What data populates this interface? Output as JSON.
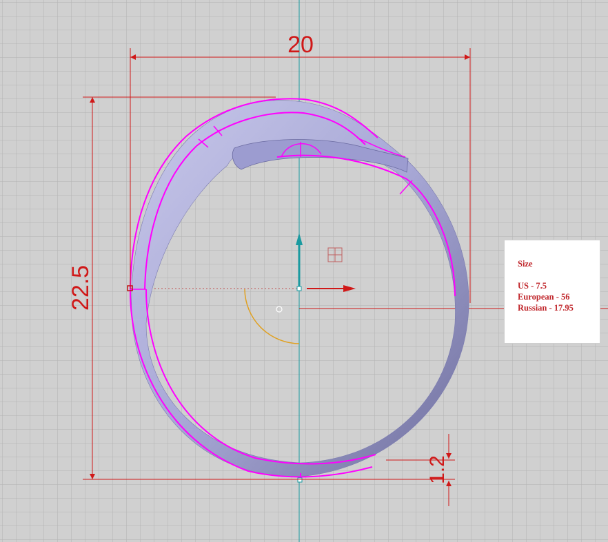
{
  "dimensions": {
    "width_label": "20",
    "height_label": "22.5",
    "thickness_label": "1.2"
  },
  "size_panel": {
    "title": "Size",
    "us": "US - 7.5",
    "european": "European - 56",
    "russian": "Russian - 17.95"
  },
  "colors": {
    "background": "#d0d0d0",
    "grid": "#b4b4b4",
    "dimension": "#d01818",
    "ring_body": "#a6a6d2",
    "ring_edges": "#ff00ff",
    "axis": "#1a9aa0",
    "arc": "#e0a020"
  }
}
